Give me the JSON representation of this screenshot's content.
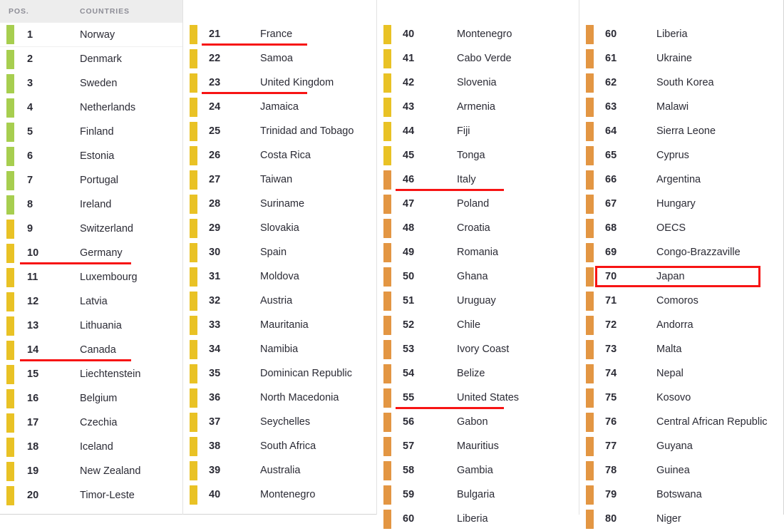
{
  "header": {
    "pos_label": "POS.",
    "countries_label": "COUNTRIES"
  },
  "legend_colors": {
    "green": "#a7ce4f",
    "yellow": "#e9c225",
    "orange": "#e39643",
    "marker_red": "#f71414",
    "header_bg": "#ededed",
    "text": "#2b2b35",
    "header_text": "#8d8d96"
  },
  "columns": [
    {
      "id": "column-1",
      "has_header": true,
      "rows": [
        {
          "pos": "1",
          "country": "Norway",
          "color": "green",
          "mark": "none"
        },
        {
          "pos": "2",
          "country": "Denmark",
          "color": "green",
          "mark": "none"
        },
        {
          "pos": "3",
          "country": "Sweden",
          "color": "green",
          "mark": "none"
        },
        {
          "pos": "4",
          "country": "Netherlands",
          "color": "green",
          "mark": "none"
        },
        {
          "pos": "5",
          "country": "Finland",
          "color": "green",
          "mark": "none"
        },
        {
          "pos": "6",
          "country": "Estonia",
          "color": "green",
          "mark": "none"
        },
        {
          "pos": "7",
          "country": "Portugal",
          "color": "green",
          "mark": "none"
        },
        {
          "pos": "8",
          "country": "Ireland",
          "color": "green",
          "mark": "none"
        },
        {
          "pos": "9",
          "country": "Switzerland",
          "color": "yellow",
          "mark": "none"
        },
        {
          "pos": "10",
          "country": "Germany",
          "color": "yellow",
          "mark": "underline",
          "mw": "germany"
        },
        {
          "pos": "11",
          "country": "Luxembourg",
          "color": "yellow",
          "mark": "none"
        },
        {
          "pos": "12",
          "country": "Latvia",
          "color": "yellow",
          "mark": "none"
        },
        {
          "pos": "13",
          "country": "Lithuania",
          "color": "yellow",
          "mark": "none"
        },
        {
          "pos": "14",
          "country": "Canada",
          "color": "yellow",
          "mark": "underline",
          "mw": "canada"
        },
        {
          "pos": "15",
          "country": "Liechtenstein",
          "color": "yellow",
          "mark": "none"
        },
        {
          "pos": "16",
          "country": "Belgium",
          "color": "yellow",
          "mark": "none"
        },
        {
          "pos": "17",
          "country": "Czechia",
          "color": "yellow",
          "mark": "none"
        },
        {
          "pos": "18",
          "country": "Iceland",
          "color": "yellow",
          "mark": "none"
        },
        {
          "pos": "19",
          "country": "New Zealand",
          "color": "yellow",
          "mark": "none"
        },
        {
          "pos": "20",
          "country": "Timor-Leste",
          "color": "yellow",
          "mark": "none"
        }
      ]
    },
    {
      "id": "column-2",
      "has_header": false,
      "rows": [
        {
          "pos": "21",
          "country": "France",
          "color": "yellow",
          "mark": "underline",
          "mw": "france"
        },
        {
          "pos": "22",
          "country": "Samoa",
          "color": "yellow",
          "mark": "none"
        },
        {
          "pos": "23",
          "country": "United Kingdom",
          "color": "yellow",
          "mark": "underline",
          "mw": "uk"
        },
        {
          "pos": "24",
          "country": "Jamaica",
          "color": "yellow",
          "mark": "none"
        },
        {
          "pos": "25",
          "country": "Trinidad and Tobago",
          "color": "yellow",
          "mark": "none"
        },
        {
          "pos": "26",
          "country": "Costa Rica",
          "color": "yellow",
          "mark": "none"
        },
        {
          "pos": "27",
          "country": "Taiwan",
          "color": "yellow",
          "mark": "none"
        },
        {
          "pos": "28",
          "country": "Suriname",
          "color": "yellow",
          "mark": "none"
        },
        {
          "pos": "29",
          "country": "Slovakia",
          "color": "yellow",
          "mark": "none"
        },
        {
          "pos": "30",
          "country": "Spain",
          "color": "yellow",
          "mark": "none"
        },
        {
          "pos": "31",
          "country": "Moldova",
          "color": "yellow",
          "mark": "none"
        },
        {
          "pos": "32",
          "country": "Austria",
          "color": "yellow",
          "mark": "none"
        },
        {
          "pos": "33",
          "country": "Mauritania",
          "color": "yellow",
          "mark": "none"
        },
        {
          "pos": "34",
          "country": "Namibia",
          "color": "yellow",
          "mark": "none"
        },
        {
          "pos": "35",
          "country": "Dominican Republic",
          "color": "yellow",
          "mark": "none"
        },
        {
          "pos": "36",
          "country": "North Macedonia",
          "color": "yellow",
          "mark": "none"
        },
        {
          "pos": "37",
          "country": "Seychelles",
          "color": "yellow",
          "mark": "none"
        },
        {
          "pos": "38",
          "country": "South Africa",
          "color": "yellow",
          "mark": "none"
        },
        {
          "pos": "39",
          "country": "Australia",
          "color": "yellow",
          "mark": "none"
        },
        {
          "pos": "40",
          "country": "Montenegro",
          "color": "yellow",
          "mark": "none"
        }
      ]
    },
    {
      "id": "column-3",
      "has_header": false,
      "rows": [
        {
          "pos": "40",
          "country": "Montenegro",
          "color": "yellow",
          "mark": "none"
        },
        {
          "pos": "41",
          "country": "Cabo Verde",
          "color": "yellow",
          "mark": "none"
        },
        {
          "pos": "42",
          "country": "Slovenia",
          "color": "yellow",
          "mark": "none"
        },
        {
          "pos": "43",
          "country": "Armenia",
          "color": "yellow",
          "mark": "none"
        },
        {
          "pos": "44",
          "country": "Fiji",
          "color": "yellow",
          "mark": "none"
        },
        {
          "pos": "45",
          "country": "Tonga",
          "color": "yellow",
          "mark": "none"
        },
        {
          "pos": "46",
          "country": "Italy",
          "color": "orange",
          "mark": "underline",
          "mw": "italy"
        },
        {
          "pos": "47",
          "country": "Poland",
          "color": "orange",
          "mark": "none"
        },
        {
          "pos": "48",
          "country": "Croatia",
          "color": "orange",
          "mark": "none"
        },
        {
          "pos": "49",
          "country": "Romania",
          "color": "orange",
          "mark": "none"
        },
        {
          "pos": "50",
          "country": "Ghana",
          "color": "orange",
          "mark": "none"
        },
        {
          "pos": "51",
          "country": "Uruguay",
          "color": "orange",
          "mark": "none"
        },
        {
          "pos": "52",
          "country": "Chile",
          "color": "orange",
          "mark": "none"
        },
        {
          "pos": "53",
          "country": "Ivory Coast",
          "color": "orange",
          "mark": "none"
        },
        {
          "pos": "54",
          "country": "Belize",
          "color": "orange",
          "mark": "none"
        },
        {
          "pos": "55",
          "country": "United States",
          "color": "orange",
          "mark": "underline",
          "mw": "usa"
        },
        {
          "pos": "56",
          "country": "Gabon",
          "color": "orange",
          "mark": "none"
        },
        {
          "pos": "57",
          "country": "Mauritius",
          "color": "orange",
          "mark": "none"
        },
        {
          "pos": "58",
          "country": "Gambia",
          "color": "orange",
          "mark": "none"
        },
        {
          "pos": "59",
          "country": "Bulgaria",
          "color": "orange",
          "mark": "none"
        },
        {
          "pos": "60",
          "country": "Liberia",
          "color": "orange",
          "mark": "none"
        }
      ]
    },
    {
      "id": "column-4",
      "has_header": false,
      "rows": [
        {
          "pos": "60",
          "country": "Liberia",
          "color": "orange",
          "mark": "none"
        },
        {
          "pos": "61",
          "country": "Ukraine",
          "color": "orange",
          "mark": "none"
        },
        {
          "pos": "62",
          "country": "South Korea",
          "color": "orange",
          "mark": "none"
        },
        {
          "pos": "63",
          "country": "Malawi",
          "color": "orange",
          "mark": "none"
        },
        {
          "pos": "64",
          "country": "Sierra Leone",
          "color": "orange",
          "mark": "none"
        },
        {
          "pos": "65",
          "country": "Cyprus",
          "color": "orange",
          "mark": "none"
        },
        {
          "pos": "66",
          "country": "Argentina",
          "color": "orange",
          "mark": "none"
        },
        {
          "pos": "67",
          "country": "Hungary",
          "color": "orange",
          "mark": "none"
        },
        {
          "pos": "68",
          "country": "OECS",
          "color": "orange",
          "mark": "none"
        },
        {
          "pos": "69",
          "country": "Congo-Brazzaville",
          "color": "orange",
          "mark": "none"
        },
        {
          "pos": "70",
          "country": "Japan",
          "color": "orange",
          "mark": "box"
        },
        {
          "pos": "71",
          "country": "Comoros",
          "color": "orange",
          "mark": "none"
        },
        {
          "pos": "72",
          "country": "Andorra",
          "color": "orange",
          "mark": "none"
        },
        {
          "pos": "73",
          "country": "Malta",
          "color": "orange",
          "mark": "none"
        },
        {
          "pos": "74",
          "country": "Nepal",
          "color": "orange",
          "mark": "none"
        },
        {
          "pos": "75",
          "country": "Kosovo",
          "color": "orange",
          "mark": "none"
        },
        {
          "pos": "76",
          "country": "Central African Republic",
          "color": "orange",
          "mark": "none"
        },
        {
          "pos": "77",
          "country": "Guyana",
          "color": "orange",
          "mark": "none"
        },
        {
          "pos": "78",
          "country": "Guinea",
          "color": "orange",
          "mark": "none"
        },
        {
          "pos": "79",
          "country": "Botswana",
          "color": "orange",
          "mark": "none"
        },
        {
          "pos": "80",
          "country": "Niger",
          "color": "orange",
          "mark": "none"
        }
      ]
    }
  ]
}
